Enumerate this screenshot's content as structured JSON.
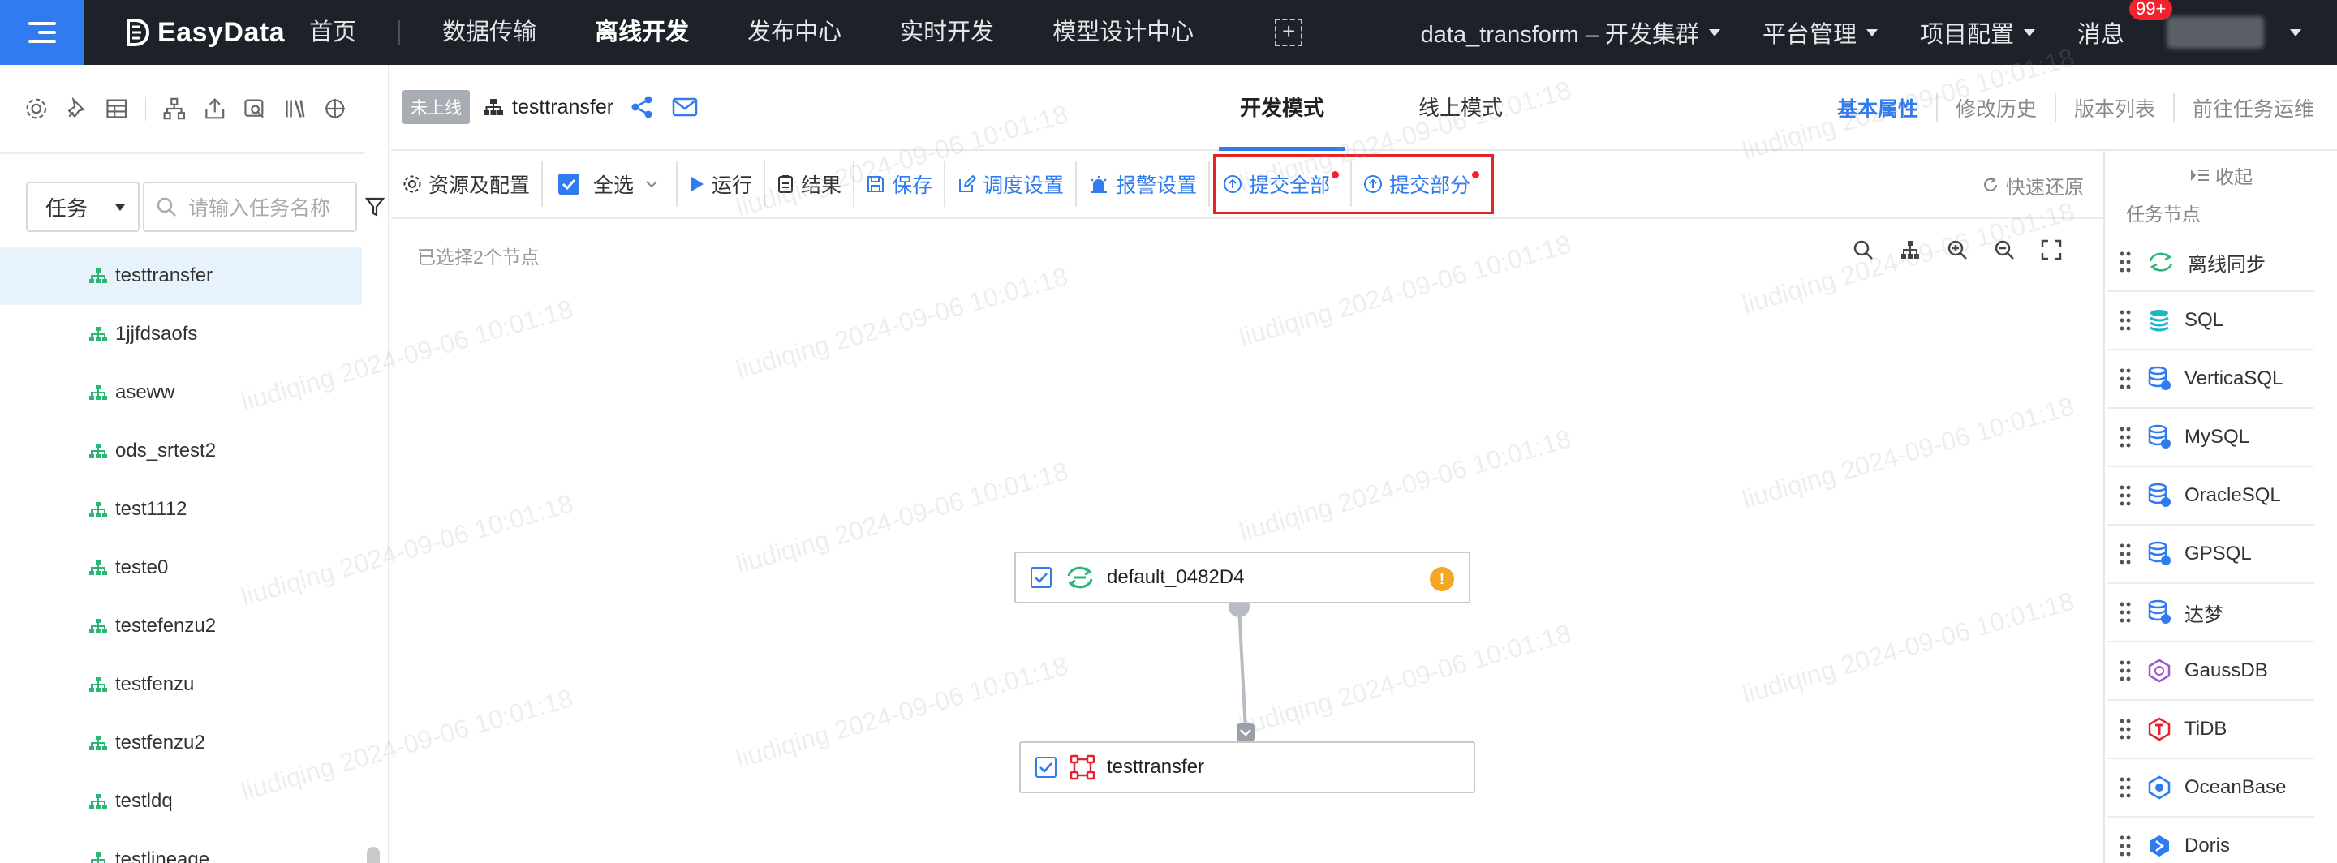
{
  "topbar": {
    "logo": "EasyData",
    "nav": [
      {
        "label": "首页",
        "active": false
      },
      {
        "label": "数据传输",
        "active": false
      },
      {
        "label": "离线开发",
        "active": true
      },
      {
        "label": "发布中心",
        "active": false
      },
      {
        "label": "实时开发",
        "active": false
      },
      {
        "label": "模型设计中心",
        "active": false
      }
    ],
    "cluster": "data_transform – 开发集群",
    "platform": "平台管理",
    "project": "项目配置",
    "messages": "消息",
    "badge": "99+"
  },
  "left": {
    "select_value": "任务",
    "search_placeholder": "请输入任务名称",
    "tasks": [
      "testtransfer",
      "1jjfdsaofs",
      "aseww",
      "ods_srtest2",
      "test1112",
      "teste0",
      "testefenzu2",
      "testfenzu",
      "testfenzu2",
      "testldq",
      "testlineage"
    ]
  },
  "tabbar": {
    "status": "未上线",
    "title": "testtransfer",
    "modes": [
      "开发模式",
      "线上模式"
    ],
    "links": [
      "基本属性",
      "修改历史",
      "版本列表",
      "前往任务运维"
    ]
  },
  "toolbar": {
    "resources": "资源及配置",
    "select_all": "全选",
    "run": "运行",
    "result": "结果",
    "save": "保存",
    "schedule": "调度设置",
    "alarm": "报警设置",
    "submit_all": "提交全部",
    "submit_part": "提交部分",
    "restore": "快速还原"
  },
  "canvas": {
    "selected_info": "已选择2个节点",
    "nodes": [
      {
        "label": "default_0482D4",
        "warning": "!"
      },
      {
        "label": "testtransfer"
      }
    ],
    "watermark": "liudiqing 2024-09-06 10:01:18"
  },
  "right": {
    "collapse": "收起",
    "title": "任务节点",
    "items": [
      "离线同步",
      "SQL",
      "VerticaSQL",
      "MySQL",
      "OracleSQL",
      "GPSQL",
      "达梦",
      "GaussDB",
      "TiDB",
      "OceanBase",
      "Doris"
    ]
  },
  "colors": {
    "accent": "#2f7bef",
    "topbar": "#1d2129",
    "highlight": "#e3242b"
  }
}
